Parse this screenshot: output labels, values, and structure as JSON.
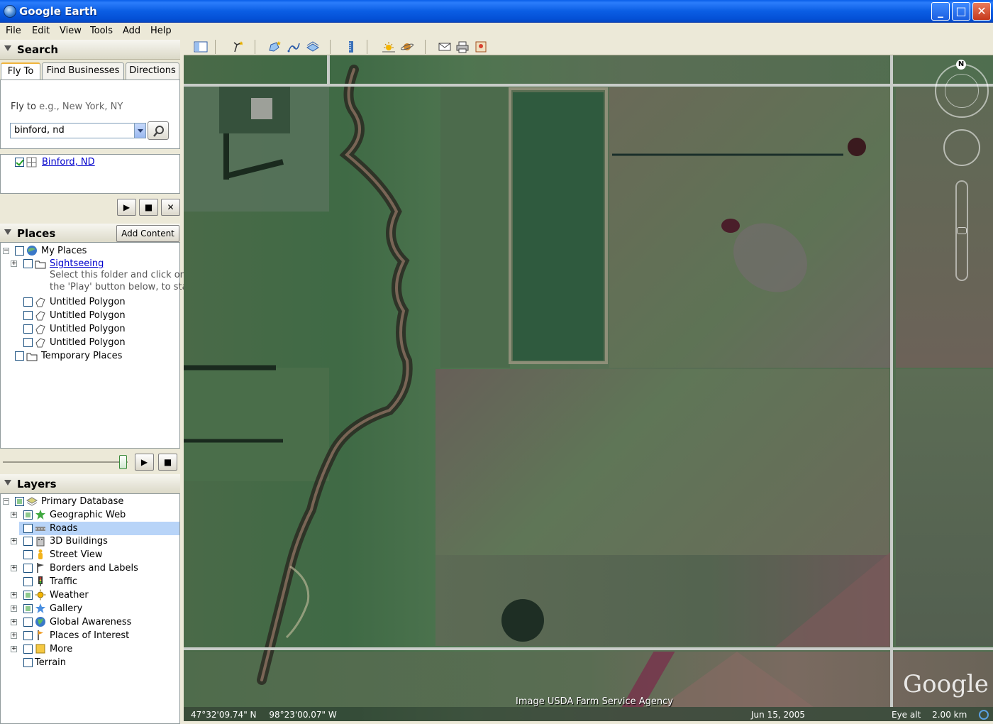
{
  "window": {
    "title": "Google Earth",
    "min": "_",
    "max": "□",
    "close": "✕"
  },
  "menu": [
    "File",
    "Edit",
    "View",
    "Tools",
    "Add",
    "Help"
  ],
  "search": {
    "header": "Search",
    "tabs": [
      "Fly To",
      "Find Businesses",
      "Directions"
    ],
    "flyto_label": "Fly to",
    "flyto_placeholder": "e.g., New York, NY",
    "query": "binford, nd",
    "result": "Binford, ND"
  },
  "places": {
    "header": "Places",
    "add_content": "Add Content",
    "items": [
      {
        "label": "My Places"
      },
      {
        "label": "Sightseeing"
      },
      {
        "label": "Select this folder and click on"
      },
      {
        "label": "the 'Play' button below, to start"
      },
      {
        "label": "Untitled Polygon"
      },
      {
        "label": "Untitled Polygon"
      },
      {
        "label": "Untitled Polygon"
      },
      {
        "label": "Untitled Polygon"
      },
      {
        "label": "Temporary Places"
      }
    ]
  },
  "layers": {
    "header": "Layers",
    "items": [
      {
        "label": "Primary Database"
      },
      {
        "label": "Geographic Web"
      },
      {
        "label": "Roads"
      },
      {
        "label": "3D Buildings"
      },
      {
        "label": "Street View"
      },
      {
        "label": "Borders and Labels"
      },
      {
        "label": "Traffic"
      },
      {
        "label": "Weather"
      },
      {
        "label": "Gallery"
      },
      {
        "label": "Global Awareness"
      },
      {
        "label": "Places of Interest"
      },
      {
        "label": "More"
      },
      {
        "label": "Terrain"
      }
    ]
  },
  "map": {
    "lat": "47°32'09.74\" N",
    "lon": "98°23'00.07\" W",
    "attribution": "Image USDA Farm Service Agency",
    "date": "Jun 15, 2005",
    "eye_alt_label": "Eye alt",
    "eye_alt_value": "2.00 km",
    "logo": "Google",
    "compass_north": "N"
  },
  "icons": [
    "sidebar-toggle-icon",
    "placemark-icon",
    "polygon-icon",
    "path-icon",
    "overlay-icon",
    "ruler-icon",
    "sun-icon",
    "planet-icon",
    "email-icon",
    "print-icon",
    "maps-icon"
  ]
}
